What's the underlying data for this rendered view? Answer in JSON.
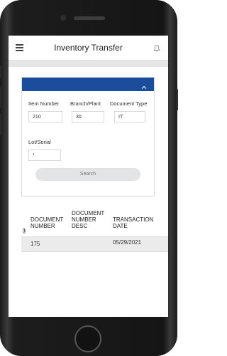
{
  "appbar": {
    "title": "Inventory Transfer",
    "menu_icon": "hamburger-menu-icon",
    "bell_icon": "bell-icon"
  },
  "search_card": {
    "header_color": "#1a4e9c",
    "collapse_icon": "chevron-up-icon",
    "fields": {
      "item_number": {
        "label": "Item Number",
        "value": "210"
      },
      "branch_plant": {
        "label": "Branch/Plant",
        "value": "30"
      },
      "document_type": {
        "label": "Document Type",
        "value": "IT"
      },
      "lot_serial": {
        "label": "Lot/Serial",
        "value": "*"
      }
    },
    "search_label": "Search"
  },
  "results": {
    "attachment_icon": "paperclip-icon",
    "columns": [
      "DOCUMENT NUMBER",
      "DOCUMENT NUMBER DESC",
      "TRANSACTION DATE"
    ],
    "rows": [
      {
        "document_number": "175",
        "document_number_desc": "",
        "transaction_date": "05/29/2021"
      }
    ]
  }
}
